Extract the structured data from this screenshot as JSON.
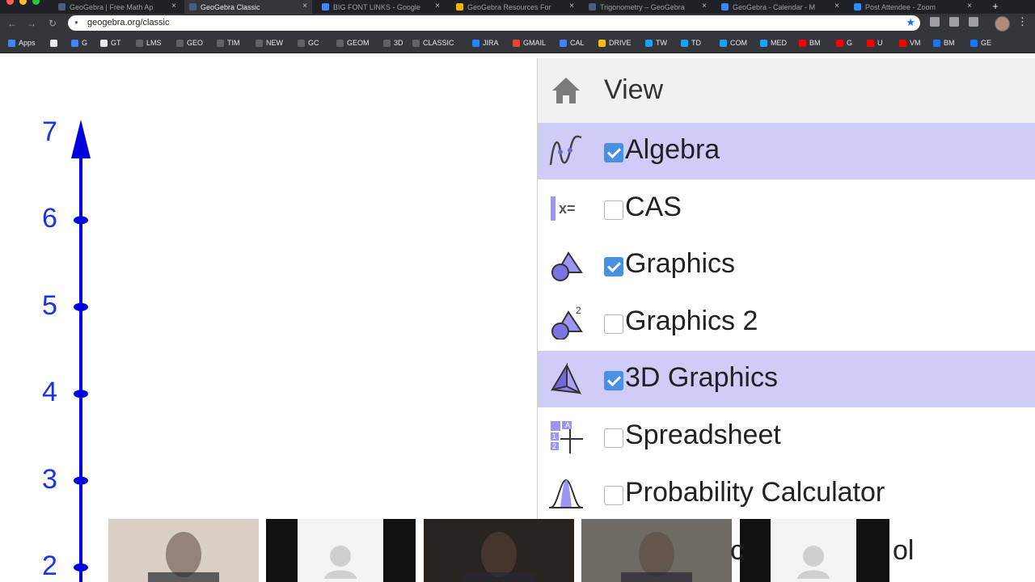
{
  "browser": {
    "tabs": [
      {
        "label": "GeoGebra | Free Math Ap",
        "fav": "#4b5d7e"
      },
      {
        "label": "GeoGebra Classic",
        "fav": "#4b5d7e",
        "active": true
      },
      {
        "label": "BIG FONT LINKS - Google",
        "fav": "#4285f4"
      },
      {
        "label": "GeoGebra Resources For",
        "fav": "#f4b400"
      },
      {
        "label": "Trigonometry – GeoGebra",
        "fav": "#4b5d7e"
      },
      {
        "label": "GeoGebra - Calendar - M",
        "fav": "#4285f4"
      },
      {
        "label": "Post Attendee - Zoom",
        "fav": "#2d8cff"
      }
    ],
    "url": "geogebra.org/classic",
    "bookmarks": [
      {
        "label": "Apps",
        "color": "#4285f4"
      },
      {
        "label": "",
        "color": "#e8eaed"
      },
      {
        "label": "G",
        "color": "#4285f4"
      },
      {
        "label": "GT",
        "color": "#e8eaed"
      },
      {
        "label": "LMS",
        "color": "#5f6368"
      },
      {
        "label": "GEO",
        "color": "#5f6368"
      },
      {
        "label": "TIM",
        "color": "#5f6368"
      },
      {
        "label": "NEW",
        "color": "#5f6368"
      },
      {
        "label": "GC",
        "color": "#5f6368"
      },
      {
        "label": "GEOM",
        "color": "#5f6368"
      },
      {
        "label": "3D",
        "color": "#5f6368"
      },
      {
        "label": "CLASSIC",
        "color": "#5f6368"
      },
      {
        "label": "JIRA",
        "color": "#2684ff"
      },
      {
        "label": "GMAIL",
        "color": "#ea4335"
      },
      {
        "label": "CAL",
        "color": "#4285f4"
      },
      {
        "label": "DRIVE",
        "color": "#fbbc04"
      },
      {
        "label": "TW",
        "color": "#1da1f2"
      },
      {
        "label": "TD",
        "color": "#1da1f2"
      },
      {
        "label": "COM",
        "color": "#1da1f2"
      },
      {
        "label": "MED",
        "color": "#1da1f2"
      },
      {
        "label": "BM",
        "color": "#ff0000"
      },
      {
        "label": "G",
        "color": "#ff0000"
      },
      {
        "label": "U",
        "color": "#ff0000"
      },
      {
        "label": "VM",
        "color": "#ff0000"
      },
      {
        "label": "BM",
        "color": "#1877f2"
      },
      {
        "label": "GE",
        "color": "#1877f2"
      }
    ]
  },
  "graphics": {
    "y_ticks": [
      "7",
      "6",
      "5",
      "4",
      "3",
      "2"
    ],
    "axis_color": "#0000e0"
  },
  "view_menu": {
    "title": "View",
    "items": [
      {
        "label": "Algebra",
        "checked": true,
        "highlighted": true,
        "icon": "algebra-icon"
      },
      {
        "label": "CAS",
        "checked": false,
        "highlighted": false,
        "icon": "cas-icon"
      },
      {
        "label": "Graphics",
        "checked": true,
        "highlighted": false,
        "icon": "graphics-icon"
      },
      {
        "label": "Graphics 2",
        "checked": false,
        "highlighted": false,
        "icon": "graphics2-icon"
      },
      {
        "label": "3D Graphics",
        "checked": true,
        "highlighted": true,
        "icon": "3d-graphics-icon"
      },
      {
        "label": "Spreadsheet",
        "checked": false,
        "highlighted": false,
        "icon": "spreadsheet-icon"
      },
      {
        "label": "Probability Calculator",
        "checked": false,
        "highlighted": false,
        "icon": "probability-icon"
      }
    ],
    "partial_item_tail": "ol",
    "partial_item_mid": "c"
  },
  "video_participants": [
    {
      "kind": "camera",
      "tone": "#d9cfc4"
    },
    {
      "kind": "black"
    },
    {
      "kind": "placeholder"
    },
    {
      "kind": "black"
    },
    {
      "kind": "camera",
      "tone": "#2a2420"
    },
    {
      "kind": "camera",
      "tone": "#6e6a64"
    },
    {
      "kind": "black"
    },
    {
      "kind": "placeholder"
    },
    {
      "kind": "black"
    }
  ]
}
